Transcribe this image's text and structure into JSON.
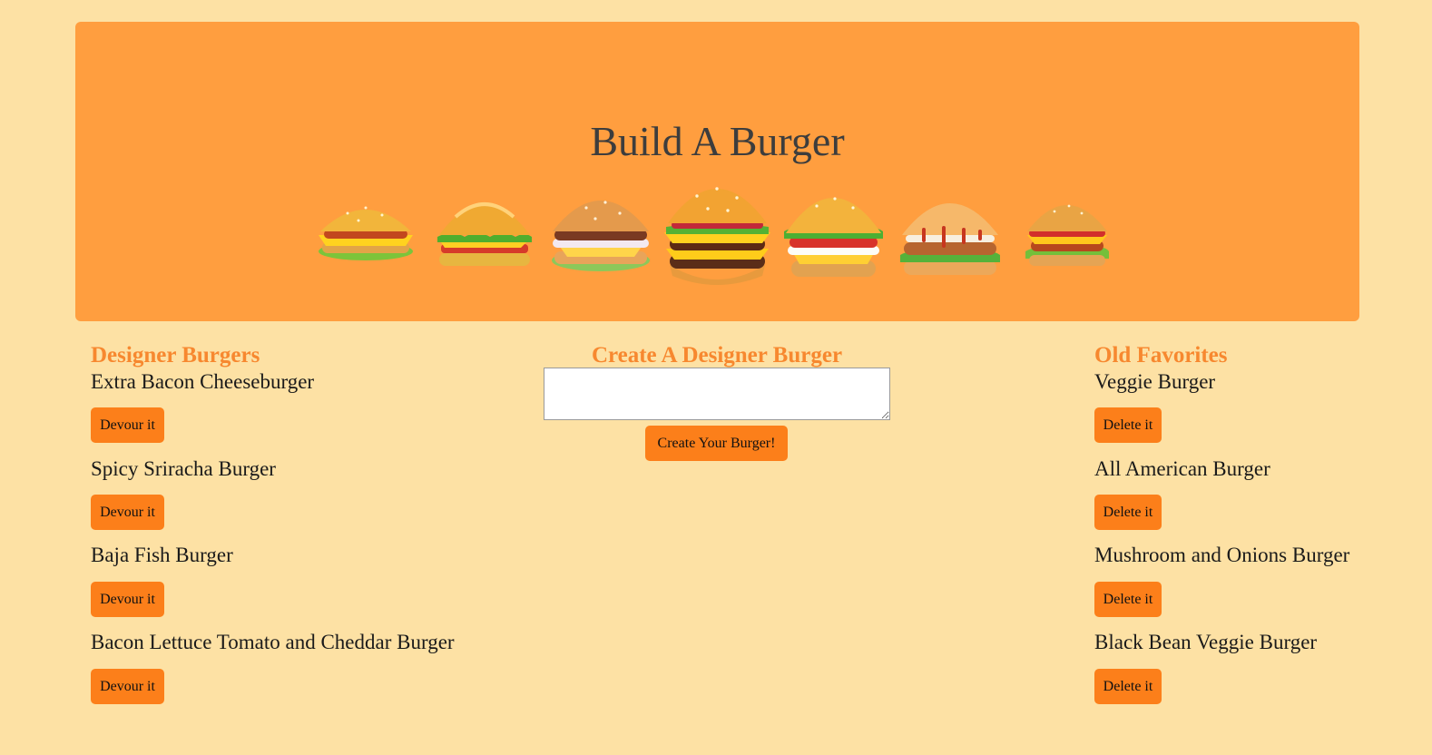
{
  "header": {
    "title": "Build A Burger",
    "burger_images": [
      "cheeseburger-icon",
      "lettuce-burger-icon",
      "deluxe-burger-icon",
      "double-bacon-burger-icon",
      "tomato-onion-burger-icon",
      "sauce-burger-icon",
      "classic-burger-icon"
    ]
  },
  "designer": {
    "title": "Designer Burgers",
    "button_label": "Devour it",
    "items": [
      "Extra Bacon Cheeseburger",
      "Spicy Sriracha Burger",
      "Baja Fish Burger",
      "Bacon Lettuce Tomato and Cheddar Burger"
    ]
  },
  "create": {
    "title": "Create A Designer Burger",
    "input_value": "",
    "submit_label": "Create Your Burger!"
  },
  "favorites": {
    "title": "Old Favorites",
    "button_label": "Delete it",
    "items": [
      "Veggie Burger",
      "All American Burger",
      "Mushroom and Onions Burger",
      "Black Bean Veggie Burger"
    ]
  },
  "colors": {
    "page_background": "#fde1a4",
    "jumbotron": "#ff9e3f",
    "accent": "#f7882f",
    "button": "#fc7f1a"
  }
}
